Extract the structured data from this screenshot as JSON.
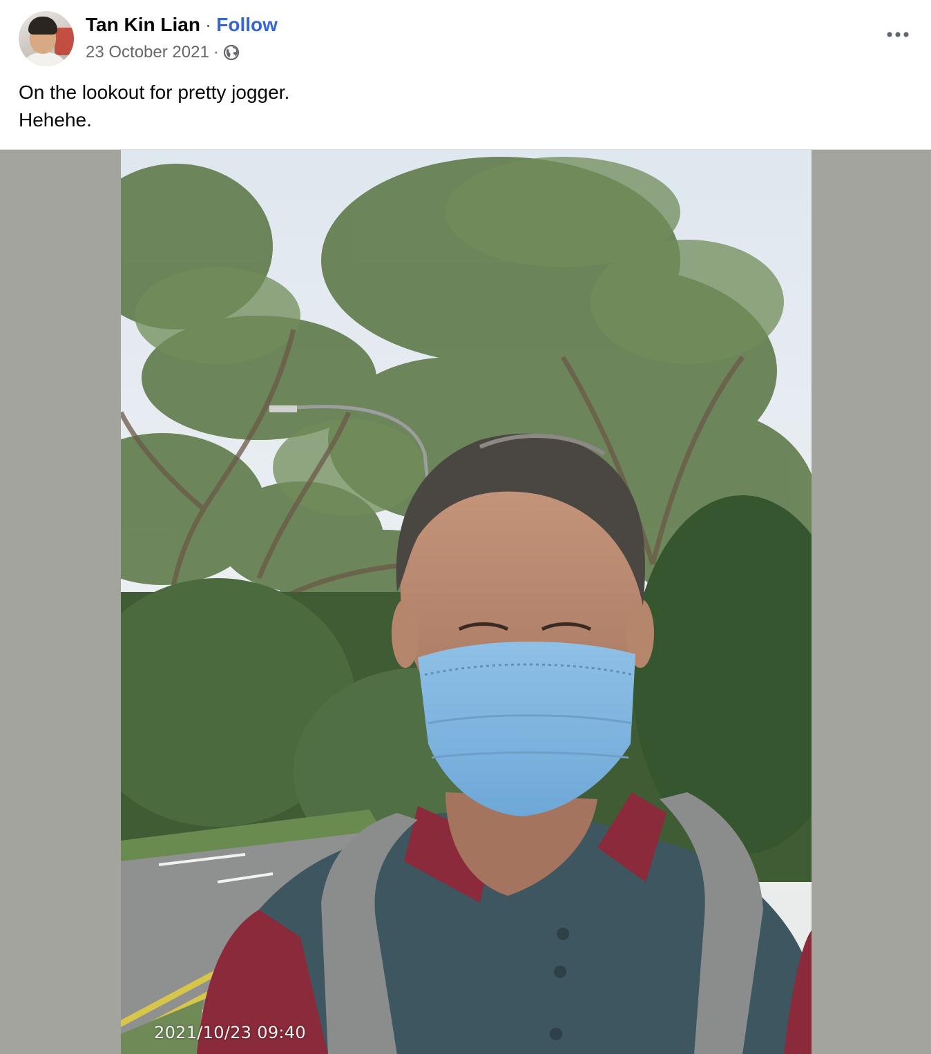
{
  "post": {
    "author_name": "Tan Kin Lian",
    "separator": "·",
    "follow_label": "Follow",
    "date": "23 October 2021",
    "meta_separator": "·",
    "privacy_icon": "globe-icon",
    "more_icon": "more-options-icon",
    "text_lines": [
      "On the lookout for pretty jogger.",
      "Hehehe."
    ]
  },
  "photo": {
    "timestamp_overlay": "2021/10/23 09:40"
  },
  "colors": {
    "follow_link": "#3566d3",
    "secondary_text": "#65676b",
    "primary_text": "#050505",
    "media_background": "#a3a49e"
  }
}
